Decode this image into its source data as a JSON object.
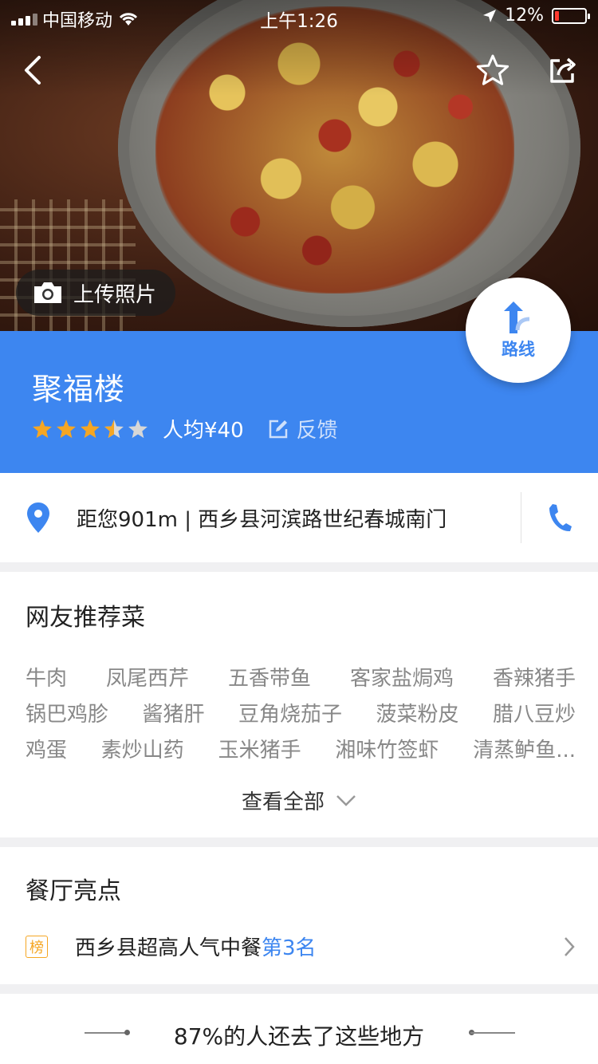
{
  "status_bar": {
    "carrier": "中国移动",
    "time": "上午1:26",
    "battery": "12%"
  },
  "hero": {
    "upload_label": "上传照片"
  },
  "restaurant": {
    "name": "聚福楼",
    "rating": 3.5,
    "avg_price": "人均¥40",
    "feedback_label": "反馈"
  },
  "route": {
    "label": "路线"
  },
  "address": {
    "text": "距您901m | 西乡县河滨路世纪春城南门"
  },
  "dishes": {
    "title": "网友推荐菜",
    "rows": [
      [
        "牛肉",
        "凤尾西芹",
        "五香带鱼",
        "客家盐焗鸡",
        "香辣猪手"
      ],
      [
        "锅巴鸡胗",
        "酱猪肝",
        "豆角烧茄子",
        "菠菜粉皮",
        "腊八豆炒"
      ],
      [
        "鸡蛋",
        "素炒山药",
        "玉米猪手",
        "湘味竹签虾",
        "清蒸鲈鱼..."
      ]
    ],
    "view_all": "查看全部"
  },
  "highlights": {
    "title": "餐厅亮点",
    "badge": "榜",
    "text": "西乡县超高人气中餐",
    "rank": "第3名"
  },
  "footer": {
    "title": "87%的人还去了这些地方"
  },
  "colors": {
    "primary": "#3d86f0",
    "star": "#f5a623",
    "badge": "#f5a623"
  }
}
